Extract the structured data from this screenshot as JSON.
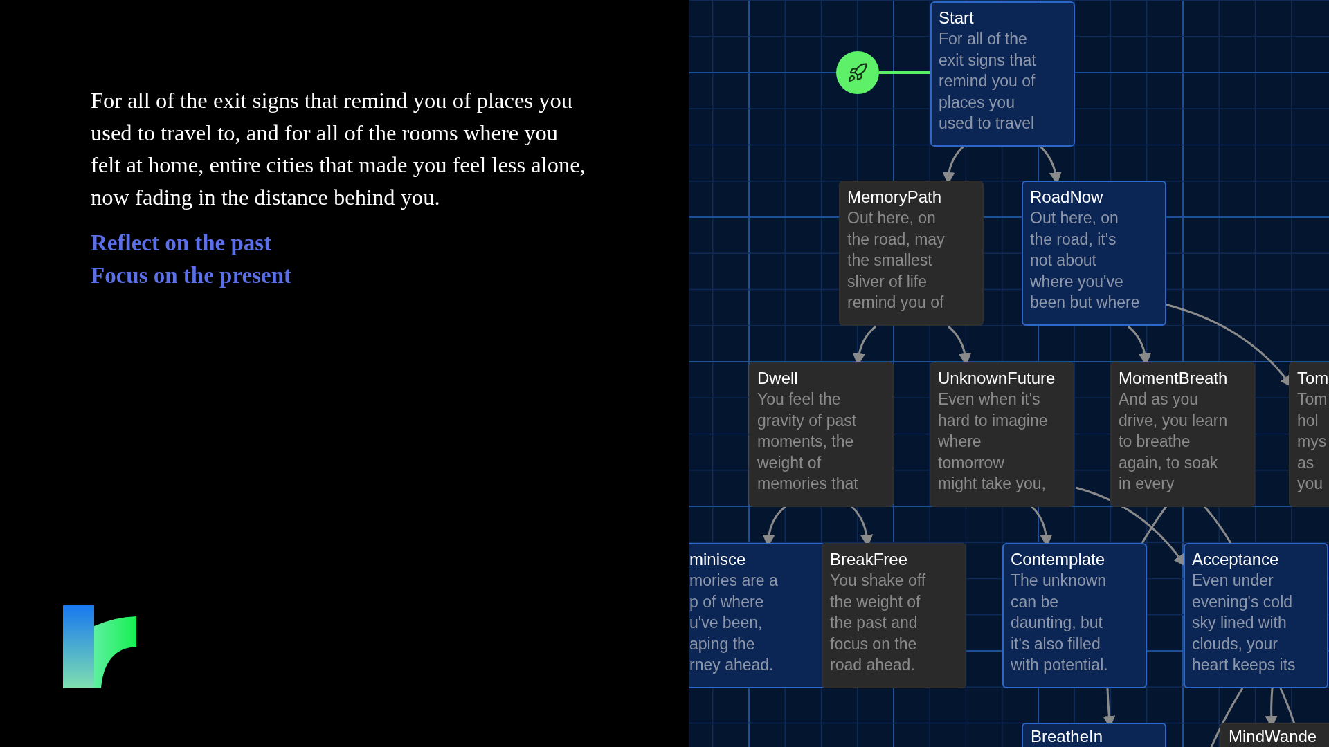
{
  "intro": {
    "paragraph": "For all of the exit signs that remind you of places you used to travel to, and for all of the rooms where you felt at home, entire cities that made you feel less alone, now fading in the distance behind you.",
    "links": [
      "Reflect on the past",
      "Focus on the present"
    ]
  },
  "diagram": {
    "nodes": [
      {
        "title": "Start",
        "text": "For all of the\nexit signs that\nremind you of\nplaces you\nused to travel",
        "active": true
      },
      {
        "title": "MemoryPath",
        "text": "Out here, on\nthe road, may\nthe smallest\nsliver of life\nremind you of",
        "active": false
      },
      {
        "title": "RoadNow",
        "text": "Out here, on\nthe road, it's\nnot about\nwhere you've\nbeen but where",
        "active": true
      },
      {
        "title": "Dwell",
        "text": "You feel the\ngravity of past\nmoments, the\nweight of\nmemories that",
        "active": false
      },
      {
        "title": "UnknownFuture",
        "text": "Even when it's\nhard to imagine\nwhere\ntomorrow\nmight take you,",
        "active": false
      },
      {
        "title": "MomentBreath",
        "text": "And as you\ndrive, you learn\nto breathe\nagain, to soak\nin every",
        "active": false
      },
      {
        "title": "Tom",
        "text": "Tom\nhol\nmys\nas\nyou",
        "active": false
      },
      {
        "title": "minisce",
        "text": "mories are a\np of where\nu've been,\naping the\nrney ahead.",
        "active": true
      },
      {
        "title": "BreakFree",
        "text": "You shake off\nthe weight of\nthe past and\nfocus on the\nroad ahead.",
        "active": false
      },
      {
        "title": "Contemplate",
        "text": "The unknown\ncan be\ndaunting, but\nit's also filled\nwith potential.",
        "active": true
      },
      {
        "title": "Acceptance",
        "text": "Even under\nevening's cold\nsky lined with\nclouds, your\nheart keeps its",
        "active": true
      },
      {
        "title": "BreatheIn",
        "active": true
      },
      {
        "title": "MindWande",
        "active": false
      }
    ]
  }
}
